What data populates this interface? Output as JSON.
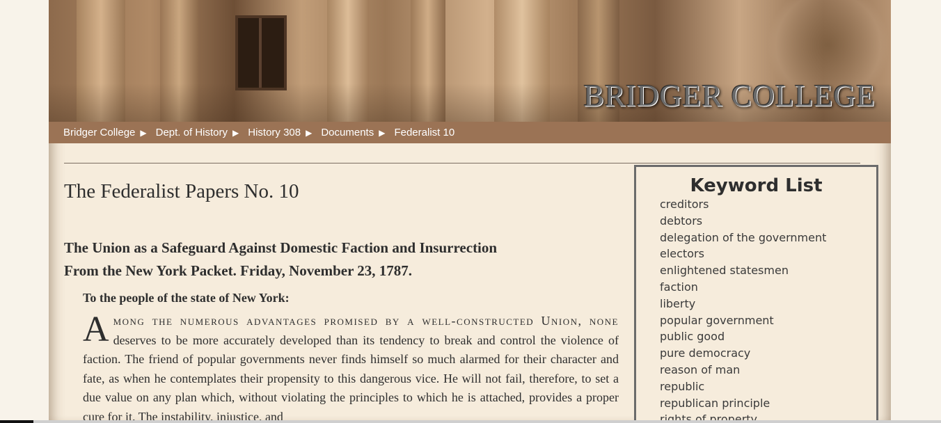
{
  "banner": {
    "title": "BRIDGER COLLEGE"
  },
  "breadcrumb": [
    {
      "label": "Bridger College"
    },
    {
      "label": "Dept. of History"
    },
    {
      "label": "History 308"
    },
    {
      "label": "Documents"
    },
    {
      "label": "Federalist 10"
    }
  ],
  "breadcrumb_separator": "▶",
  "article": {
    "title": "The Federalist Papers No. 10",
    "subtitle_line1": "The Union as a Safeguard Against Domestic Faction and Insurrection",
    "subtitle_line2": "From the New York Packet. Friday, November 23, 1787.",
    "salutation": "To the people of the state of New York:",
    "drop_cap": "A",
    "lead_smallcaps": "mong the numerous advantages promised by a well-constructed Union, none",
    "body_text": "deserves to be more accurately developed than its tendency to break and control the violence of faction. The friend of popular governments never finds himself so much alarmed for their character and fate, as when he contemplates their propensity to this dangerous vice. He will not fail, therefore, to set a due value on any plan which, without violating the principles to which he is attached, provides a proper cure for it. The instability, injustice, and"
  },
  "keyword_list": {
    "title": "Keyword List",
    "items": [
      "creditors",
      "debtors",
      "delegation of the government",
      "electors",
      "enlightened statesmen",
      "faction",
      "liberty",
      "popular government",
      "public good",
      "pure democracy",
      "reason of man",
      "republic",
      "republican principle",
      "rights of property"
    ]
  }
}
